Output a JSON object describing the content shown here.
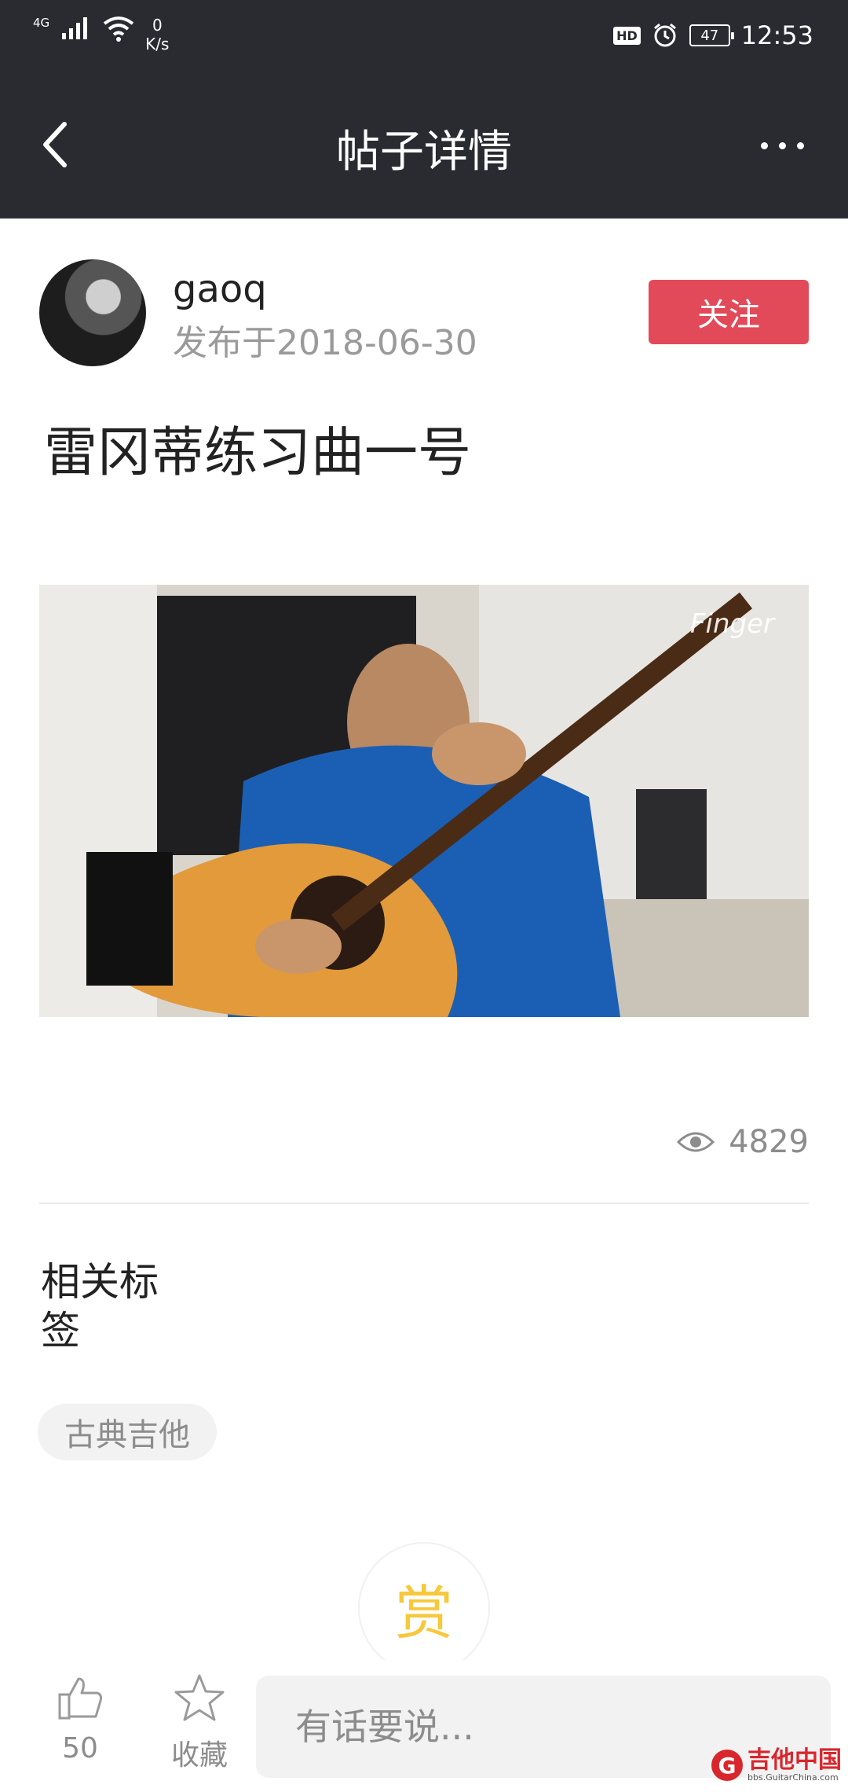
{
  "status_bar": {
    "network": "4G",
    "speed_value": "0",
    "speed_unit": "K/s",
    "hd": "HD",
    "battery": "47",
    "time": "12:53"
  },
  "nav": {
    "title": "帖子详情"
  },
  "author": {
    "username": "gaoq",
    "date": "发布于2018-06-30",
    "follow_label": "关注"
  },
  "post": {
    "title": "雷冈蒂练习曲一号",
    "video_watermark": "Finger",
    "views": "4829"
  },
  "tags": {
    "heading": "相关标签",
    "items": [
      "古典吉他"
    ]
  },
  "reward": {
    "label": "赏"
  },
  "bottom_bar": {
    "likes": "50",
    "favorite_label": "收藏",
    "comment_placeholder": "有话要说..."
  },
  "site_logo": {
    "name": "吉他中国",
    "url_text": "bbs.GuitarChina.com"
  },
  "colors": {
    "topbar": "#2a2b30",
    "accent": "#e24a59",
    "reward": "#f7c83a"
  }
}
